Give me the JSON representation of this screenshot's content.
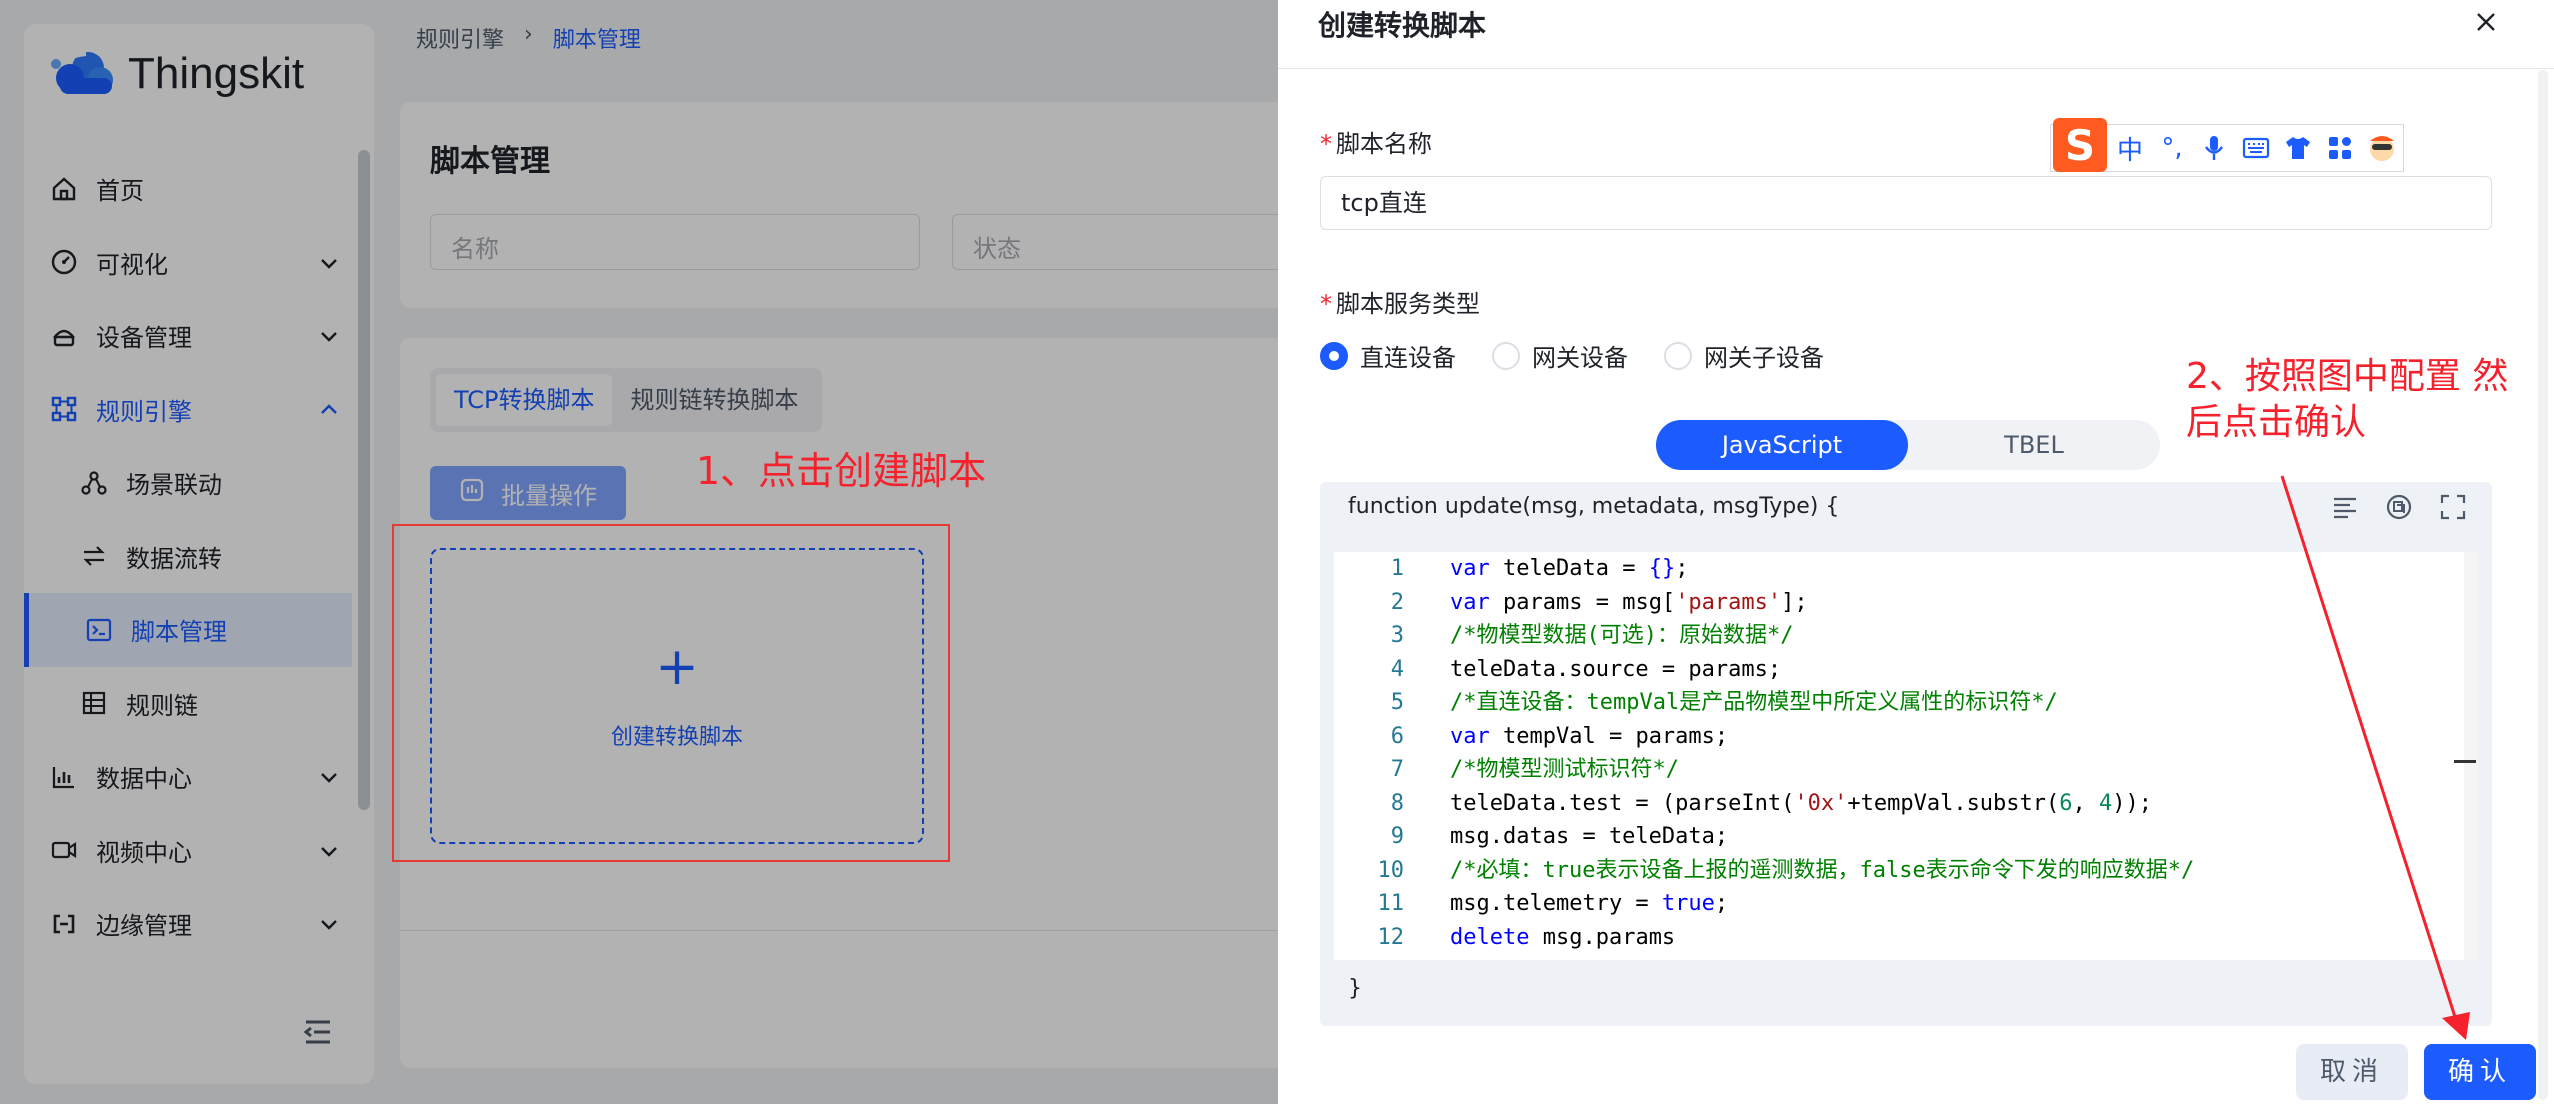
{
  "app": {
    "logo_text": "Thingskit"
  },
  "sidebar": {
    "items": [
      {
        "label": "首页",
        "icon": "home-icon"
      },
      {
        "label": "可视化",
        "icon": "dashboard-icon"
      },
      {
        "label": "设备管理",
        "icon": "device-icon"
      },
      {
        "label": "规则引擎",
        "icon": "rule-engine-icon"
      },
      {
        "label": "场景联动",
        "icon": "scene-icon"
      },
      {
        "label": "数据流转",
        "icon": "flow-icon"
      },
      {
        "label": "脚本管理",
        "icon": "script-icon"
      },
      {
        "label": "规则链",
        "icon": "rule-chain-icon"
      },
      {
        "label": "数据中心",
        "icon": "chart-icon"
      },
      {
        "label": "视频中心",
        "icon": "video-icon"
      },
      {
        "label": "边缘管理",
        "icon": "edge-icon"
      }
    ]
  },
  "breadcrumb": {
    "parent": "规则引擎",
    "current": "脚本管理"
  },
  "search": {
    "title": "脚本管理",
    "name_placeholder": "名称",
    "status_placeholder": "状态"
  },
  "list": {
    "tabs": [
      "TCP转换脚本",
      "规则链转换脚本"
    ],
    "batch_label": "批量操作",
    "create_plus": "+",
    "create_label": "创建转换脚本"
  },
  "annotations": {
    "step1": "1、点击创建脚本",
    "step2": "2、按照图中配置 然后点击确认"
  },
  "drawer": {
    "title": "创建转换脚本",
    "name_label": "脚本名称",
    "name_value": "tcp直连",
    "type_label": "脚本服务类型",
    "radios": [
      {
        "label": "直连设备",
        "checked": true
      },
      {
        "label": "网关设备",
        "checked": false
      },
      {
        "label": "网关子设备",
        "checked": false
      }
    ],
    "langs": [
      "JavaScript",
      "TBEL"
    ],
    "code_header": "function update(msg, metadata, msgType) {",
    "code_footer": "}",
    "cancel_label": "取消",
    "ok_label": "确认"
  },
  "code": {
    "lines": [
      {
        "n": "1",
        "parts": [
          [
            "kw",
            "var"
          ],
          [
            "t",
            " teleData = "
          ],
          [
            "kw",
            "{}"
          ],
          [
            "t",
            ";"
          ]
        ]
      },
      {
        "n": "2",
        "parts": [
          [
            "kw",
            "var"
          ],
          [
            "t",
            " params = msg["
          ],
          [
            "str",
            "'params'"
          ],
          [
            "t",
            "];"
          ]
        ]
      },
      {
        "n": "3",
        "parts": [
          [
            "cm",
            "/*物模型数据(可选)：原始数据*/"
          ]
        ]
      },
      {
        "n": "4",
        "parts": [
          [
            "t",
            "teleData.source = params;"
          ]
        ]
      },
      {
        "n": "5",
        "parts": [
          [
            "cm",
            "/*直连设备：tempVal是产品物模型中所定义属性的标识符*/"
          ]
        ]
      },
      {
        "n": "6",
        "parts": [
          [
            "kw",
            "var"
          ],
          [
            "t",
            " tempVal = params;"
          ]
        ]
      },
      {
        "n": "7",
        "parts": [
          [
            "cm",
            "/*物模型测试标识符*/"
          ]
        ]
      },
      {
        "n": "8",
        "parts": [
          [
            "t",
            "teleData.test = (parseInt("
          ],
          [
            "str",
            "'0x'"
          ],
          [
            "t",
            "+tempVal.substr("
          ],
          [
            "num",
            "6"
          ],
          [
            "t",
            ", "
          ],
          [
            "num",
            "4"
          ],
          [
            "t",
            "));"
          ]
        ]
      },
      {
        "n": "9",
        "parts": [
          [
            "t",
            "msg.datas = teleData;"
          ]
        ]
      },
      {
        "n": "10",
        "parts": [
          [
            "cm",
            "/*必填：true表示设备上报的遥测数据，false表示命令下发的响应数据*/"
          ]
        ]
      },
      {
        "n": "11",
        "parts": [
          [
            "t",
            "msg.telemetry = "
          ],
          [
            "kw",
            "true"
          ],
          [
            "t",
            ";"
          ]
        ]
      },
      {
        "n": "12",
        "parts": [
          [
            "kw",
            "delete"
          ],
          [
            "t",
            " msg.params"
          ]
        ]
      }
    ]
  },
  "ime": {
    "logo": "S",
    "lang": "中",
    "punct": "°,"
  }
}
